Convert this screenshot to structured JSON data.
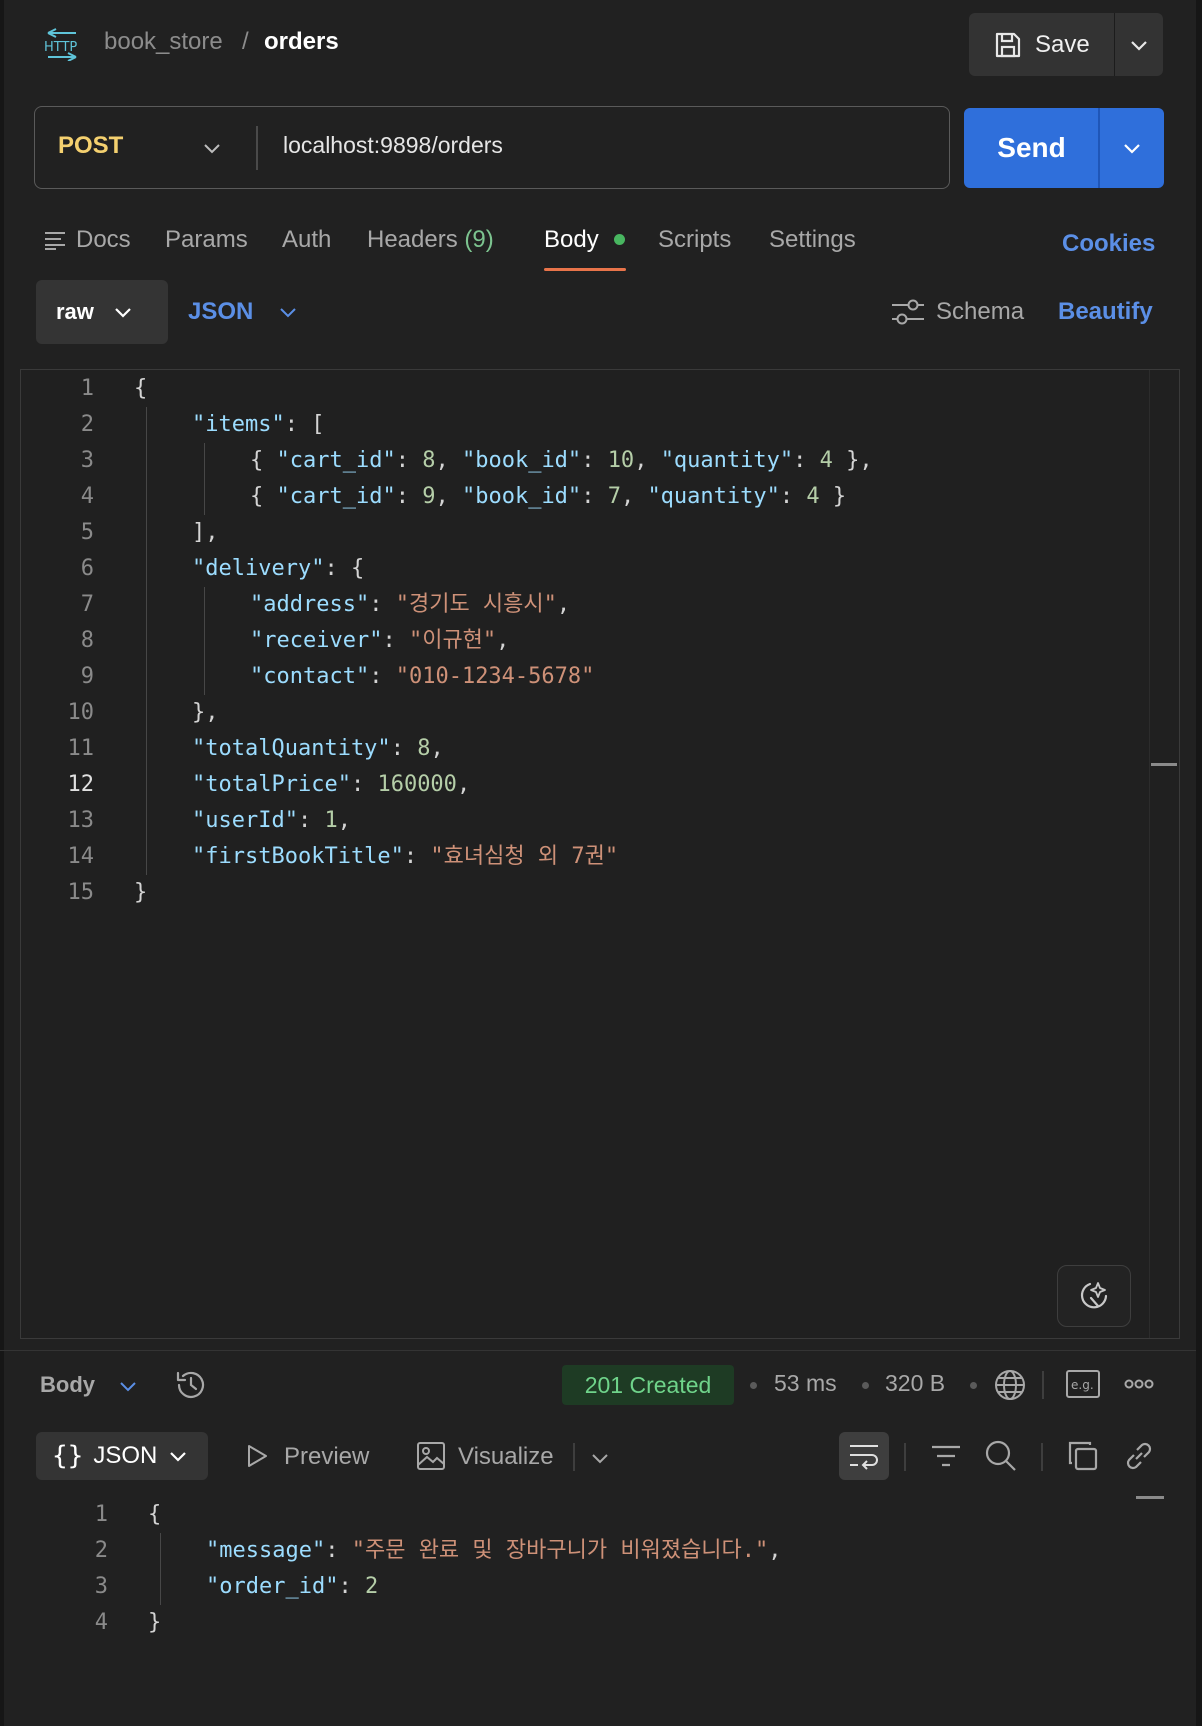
{
  "header": {
    "collection": "book_store",
    "separator": "/",
    "request_name": "orders",
    "save_label": "Save"
  },
  "request": {
    "method": "POST",
    "url": "localhost:9898/orders",
    "send_label": "Send"
  },
  "tabs": {
    "docs": "Docs",
    "params": "Params",
    "auth": "Auth",
    "headers": "Headers",
    "headers_count": "(9)",
    "body": "Body",
    "scripts": "Scripts",
    "settings": "Settings",
    "cookies": "Cookies"
  },
  "body_options": {
    "mode": "raw",
    "language": "JSON",
    "schema": "Schema",
    "beautify": "Beautify"
  },
  "request_body": {
    "current_line": 12,
    "lines": [
      "{",
      "\"items\": [",
      "{ \"cart_id\": 8, \"book_id\": 10, \"quantity\": 4 },",
      "{ \"cart_id\": 9, \"book_id\": 7, \"quantity\": 4 }",
      "],",
      "\"delivery\": {",
      "\"address\": \"경기도 시흥시\",",
      "\"receiver\": \"이규현\",",
      "\"contact\": \"010-1234-5678\"",
      "},",
      "\"totalQuantity\": 8,",
      "\"totalPrice\": 160000,",
      "\"userId\": 1,",
      "\"firstBookTitle\": \"효녀심청 외 7권\"",
      "}"
    ]
  },
  "response": {
    "body_label": "Body",
    "status": "201 Created",
    "time": "53 ms",
    "size": "320 B",
    "view_json": "JSON",
    "preview": "Preview",
    "visualize": "Visualize",
    "lines": [
      "{",
      "\"message\": \"주문 완료 및 장바구니가 비워졌습니다.\",",
      "\"order_id\": 2",
      "}"
    ]
  }
}
